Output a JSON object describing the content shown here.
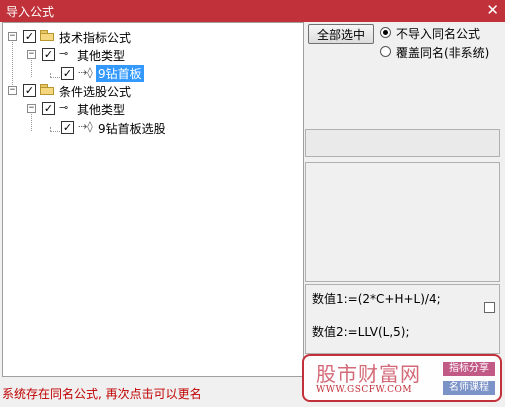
{
  "window": {
    "title": "导入公式",
    "close_glyph": "✕"
  },
  "tree": {
    "nodes": [
      {
        "label": "技术指标公式",
        "checked": true,
        "expanded": true,
        "icon": "folder-icon"
      },
      {
        "label": "其他类型",
        "checked": true,
        "expanded": true,
        "icon": "key-icon"
      },
      {
        "label": "9钻首板",
        "checked": true,
        "selected": true,
        "icon": "formula-icon"
      },
      {
        "label": "条件选股公式",
        "checked": true,
        "expanded": true,
        "icon": "folder-icon"
      },
      {
        "label": "其他类型",
        "checked": true,
        "expanded": true,
        "icon": "key-icon"
      },
      {
        "label": "9钻首板选股",
        "checked": true,
        "icon": "formula-icon"
      }
    ]
  },
  "options": {
    "select_all_label": "全部选中",
    "radio1_label": "不导入同名公式",
    "radio1_selected": true,
    "radio2_label": "覆盖同名(非系统)",
    "radio2_selected": false
  },
  "formula": {
    "line1": "数值1:=(2*C+H+L)/4;",
    "line2": "数值2:=LLV(L,5);"
  },
  "status": {
    "text": "系统存在同名公式, 再次点击可以更名"
  },
  "watermark": {
    "brand": "股市财富网",
    "url": "WWW.GSCFW.COM",
    "tag1": "指标分享",
    "tag2": "名师课程"
  },
  "colors": {
    "titlebar": "#c0313a",
    "selection": "#3399ff",
    "status": "#c00000"
  }
}
